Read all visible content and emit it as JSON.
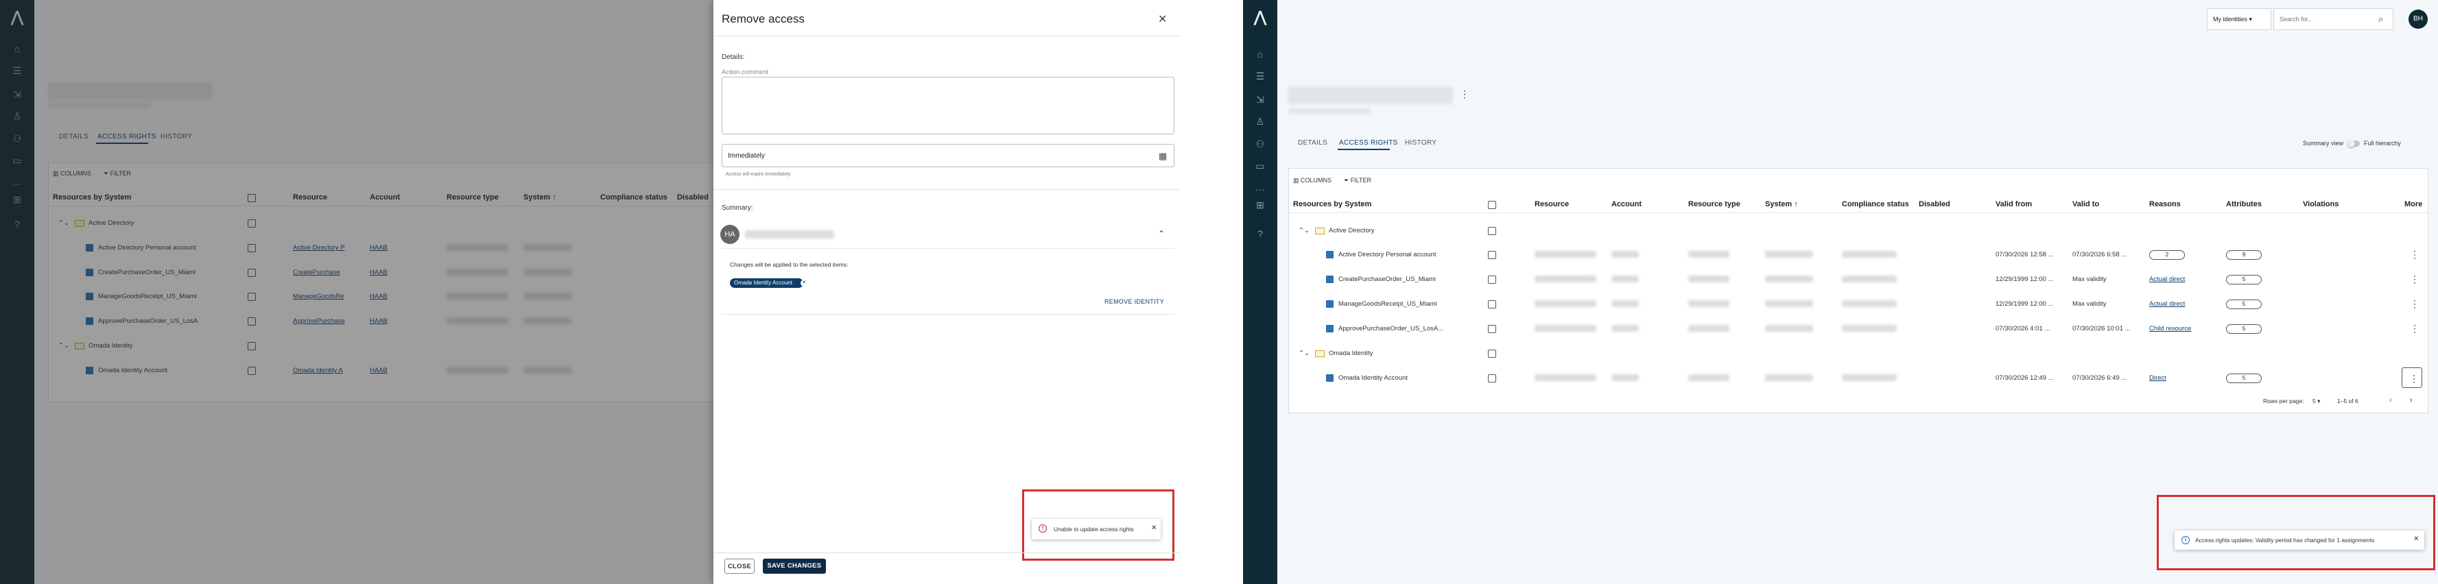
{
  "left": {
    "tabs": [
      "DETAILS",
      "ACCESS RIGHTS",
      "HISTORY"
    ],
    "toolbar": {
      "columns": "COLUMNS",
      "filter": "FILTER"
    },
    "headers": [
      "Resources by System",
      "Resource",
      "Account",
      "Resource type",
      "System ↑",
      "Compliance status",
      "Disabled"
    ],
    "groups": [
      {
        "name": "Active Directory",
        "rows": [
          {
            "label": "Active Directory Personal account",
            "resource": "Active Directory P",
            "account": "HAAB"
          },
          {
            "label": "CreatePurchaseOrder_US_Miami",
            "resource": "CreatePurchase",
            "account": "HAAB"
          },
          {
            "label": "ManageGoodsReceipt_US_Miami",
            "resource": "ManageGoodsRe",
            "account": "HAAB"
          },
          {
            "label": "ApprovePurchaseOrder_US_LosA",
            "resource": "ApprovePurchase",
            "account": "HAAB"
          }
        ]
      },
      {
        "name": "Omada Identity",
        "rows": [
          {
            "label": "Omada Identity Account",
            "resource": "Omada Identity A",
            "account": "HAAB"
          }
        ]
      }
    ]
  },
  "dialog": {
    "title": "Remove access",
    "details_label": "Details:",
    "comment_placeholder": "Action comment",
    "when_value": "Immediately",
    "when_hint": "Access will expire immediately",
    "summary_label": "Summary:",
    "avatar_initials": "HA",
    "changes_text": "Changes will be applied to the selected items:",
    "chip_label": "Omada Identity Account",
    "remove_identity": "REMOVE IDENTITY",
    "close_button": "CLOSE",
    "save_button": "SAVE CHANGES",
    "error_toast": "Unable to update access rights"
  },
  "right": {
    "topbar": {
      "identity_select": "My identities",
      "search_placeholder": "Search for...",
      "avatar": "BH"
    },
    "tabs": [
      "DETAILS",
      "ACCESS RIGHTS",
      "HISTORY"
    ],
    "summary_view": "Summary view",
    "full_hierarchy": "Full hierarchy",
    "toolbar": {
      "columns": "COLUMNS",
      "filter": "FILTER"
    },
    "headers": [
      "Resources by System",
      "Resource",
      "Account",
      "Resource type",
      "System ↑",
      "Compliance status",
      "Disabled",
      "Valid from",
      "Valid to",
      "Reasons",
      "Attributes",
      "Violations",
      "More"
    ],
    "groups": [
      {
        "name": "Active Directory",
        "rows": [
          {
            "label": "Active Directory Personal account",
            "valid_from": "07/30/2026 12:58 ...",
            "valid_to": "07/30/2026 6:58 ...",
            "reason": "2",
            "reason_type": "pill",
            "attributes": "9"
          },
          {
            "label": "CreatePurchaseOrder_US_Miami",
            "valid_from": "12/29/1999 12:00 ...",
            "valid_to": "Max validity",
            "reason": "Actual direct",
            "reason_type": "link",
            "attributes": "5"
          },
          {
            "label": "ManageGoodsReceipt_US_Miami",
            "valid_from": "12/29/1999 12:00 ...",
            "valid_to": "Max validity",
            "reason": "Actual direct",
            "reason_type": "link",
            "attributes": "5"
          },
          {
            "label": "ApprovePurchaseOrder_US_LosA...",
            "valid_from": "07/30/2026 4:01 ...",
            "valid_to": "07/30/2026 10:01 ...",
            "reason": "Child resource",
            "reason_type": "link",
            "attributes": "5"
          }
        ]
      },
      {
        "name": "Omada Identity",
        "rows": [
          {
            "label": "Omada Identity Account",
            "valid_from": "07/30/2026 12:49 ...",
            "valid_to": "07/30/2026 6:49 ...",
            "reason": "Direct",
            "reason_type": "link",
            "attributes": "5"
          }
        ]
      }
    ],
    "pagination": {
      "rows_per_page_label": "Rows per page:",
      "rows_per_page": "5",
      "range": "1–5 of 6"
    },
    "info_toast": "Access rights updates: Validity period has changed for 1 assignments"
  }
}
